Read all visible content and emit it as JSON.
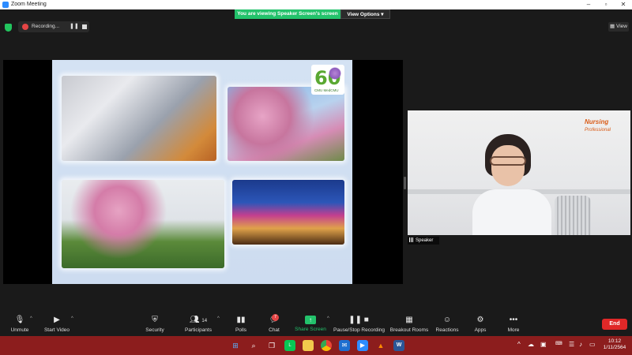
{
  "window": {
    "title": "Zoom Meeting"
  },
  "banner": {
    "message": "You are viewing Speaker Screen's screen",
    "options_label": "View Options"
  },
  "recording": {
    "label": "Recording...",
    "pause_icon": "pause-icon",
    "stop_icon": "stop-icon"
  },
  "view_button": {
    "label": "View"
  },
  "speaker": {
    "label": "Speaker",
    "brand_line1": "Nursing",
    "brand_line2": "Professional"
  },
  "slide": {
    "logo_number": "60",
    "logo_caption": "CMU MedCMU"
  },
  "toolbar": {
    "unmute": "Unmute",
    "start_video": "Start Video",
    "security": "Security",
    "participants": "Participants",
    "participants_count": "14",
    "polls": "Polls",
    "chat": "Chat",
    "chat_badge": "7",
    "share_screen": "Share Screen",
    "pause_stop_recording": "Pause/Stop Recording",
    "breakout_rooms": "Breakout Rooms",
    "reactions": "Reactions",
    "apps": "Apps",
    "more": "More",
    "end": "End"
  },
  "taskbar": {
    "icons": [
      "windows-start-icon",
      "search-icon",
      "task-view-icon",
      "line-app-icon",
      "file-explorer-icon",
      "chrome-icon",
      "mail-icon",
      "zoom-icon",
      "vlc-icon",
      "word-icon"
    ],
    "clock_time": "10:12",
    "clock_date": "1/11/2564"
  },
  "colors": {
    "accent_green": "#23c26b",
    "end_red": "#e02828",
    "taskbar": "#8c1d1d"
  }
}
